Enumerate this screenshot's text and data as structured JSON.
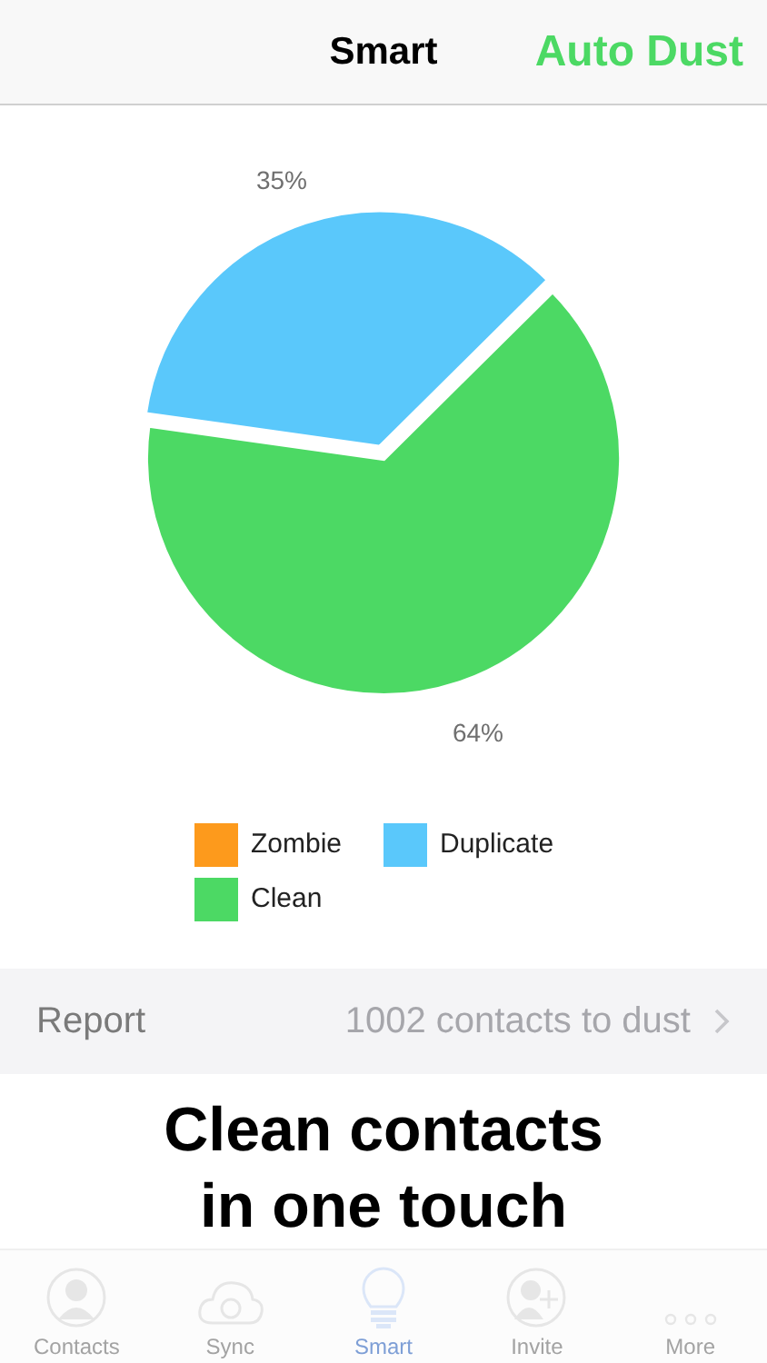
{
  "nav": {
    "title": "Smart",
    "action": "Auto Dust"
  },
  "chart_data": {
    "type": "pie",
    "categories": [
      "Zombie",
      "Duplicate",
      "Clean"
    ],
    "series": [
      {
        "values": [
          0,
          35,
          64
        ]
      }
    ],
    "colors": [
      "#fd9a1c",
      "#5ac8fb",
      "#4cd964"
    ],
    "value_labels": [
      null,
      "35%",
      "64%"
    ]
  },
  "report": {
    "label": "Report",
    "value": "1002 contacts to dust"
  },
  "caption_lines": [
    "Clean contacts",
    "in one touch"
  ],
  "tabs": [
    {
      "label": "Contacts",
      "kind": "contacts",
      "selected": false
    },
    {
      "label": "Sync",
      "kind": "sync",
      "selected": false
    },
    {
      "label": "Smart",
      "kind": "smart",
      "selected": true
    },
    {
      "label": "Invite",
      "kind": "invite",
      "selected": false
    },
    {
      "label": "More",
      "kind": "more",
      "selected": false
    }
  ]
}
